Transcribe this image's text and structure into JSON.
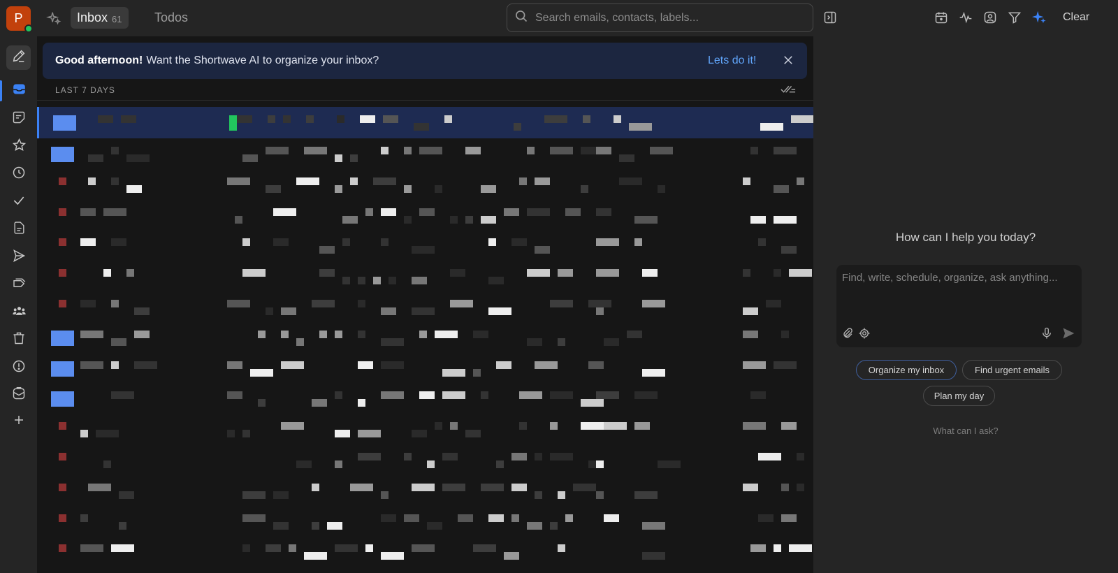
{
  "header": {
    "avatar_letter": "P",
    "tabs": [
      {
        "label": "Inbox",
        "count": "61"
      },
      {
        "label": "Todos"
      }
    ],
    "search_placeholder": "Search emails, contacts, labels...",
    "clear_label": "Clear",
    "right_icons": [
      "calendar-icon",
      "activity-icon",
      "contact-icon",
      "filter-icon",
      "ai-sparkle-icon"
    ]
  },
  "sidebar": {
    "items": [
      "compose-icon",
      "inbox-icon",
      "notes-icon",
      "star-icon",
      "clock-icon",
      "check-icon",
      "document-icon",
      "send-icon",
      "labels-icon",
      "groups-icon",
      "trash-icon",
      "alert-icon",
      "mailbox-icon",
      "plus-icon"
    ]
  },
  "banner": {
    "greeting": "Good afternoon!",
    "message": "Want the Shortwave AI to organize your inbox?",
    "cta": "Lets do it!"
  },
  "inbox": {
    "section_label": "LAST 7 DAYS"
  },
  "assistant": {
    "title": "How can I help you today?",
    "input_placeholder": "Find, write, schedule, organize, ask anything...",
    "suggestions": [
      "Organize my inbox",
      "Find urgent emails",
      "Plan my day"
    ],
    "help_link": "What can I ask?"
  },
  "colors": {
    "accent": "#3b82f6",
    "link": "#60a5fa",
    "banner_bg": "#1c2640",
    "selected_row": "#1e2b52",
    "avatar_bg": "#c2410c"
  }
}
